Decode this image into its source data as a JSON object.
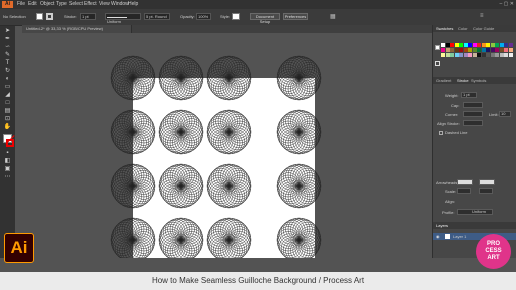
{
  "app": {
    "logo": "Ai",
    "logo_color": "#ff9a00"
  },
  "menubar": {
    "items": [
      "File",
      "Edit",
      "Object",
      "Type",
      "Select",
      "Effect",
      "View",
      "Window",
      "Help"
    ],
    "window_controls": "–  ▢  ✕"
  },
  "controlbar": {
    "selection": "No Selection",
    "stroke_label": "Stroke:",
    "stroke_value": "1 pt",
    "brush_label": "Uniform",
    "brush_style": "5 pt. Round",
    "opacity_label": "Opacity:",
    "opacity_value": "100%",
    "style_label": "Style:",
    "document_setup": "Document Setup",
    "preferences": "Preferences"
  },
  "document": {
    "tab_title": "Untitled-2* @ 33,33 % (RGB/CPU Preview)"
  },
  "panels": {
    "top_tabs": [
      "Swatches",
      "Color",
      "Color Guide"
    ],
    "mid_tabs": [
      "Gradient",
      "Stroke",
      "Symbols"
    ],
    "stroke": {
      "weight_label": "Weight:",
      "weight_value": "1 pt",
      "cap_label": "Cap:",
      "corner_label": "Corner:",
      "limit_label": "Limit:",
      "limit_value": "10",
      "align_label": "Align Stroke:",
      "dashed_label": "Dashed Line",
      "arrowheads_label": "Arrowheads:",
      "scale_label": "Scale:",
      "align_arrows_label": "Align:",
      "profile_label": "Profile:",
      "profile_value": "Uniform"
    },
    "layers": {
      "tab": "Layers",
      "layer_name": "Layer 1"
    }
  },
  "badge": {
    "line1": "PRO",
    "line2": "CESS",
    "line3": "ART"
  },
  "caption": "How to Make Seamless Guilloche Background  /  Process Art",
  "swatch_colors": [
    "#ffffff",
    "#000000",
    "#ff0000",
    "#ffff00",
    "#00ff00",
    "#00ffff",
    "#0000ff",
    "#ff00ff",
    "#ed1c24",
    "#f7941d",
    "#fff200",
    "#8dc63f",
    "#00a651",
    "#00aeef",
    "#2e3192",
    "#662d91",
    "#ec008c",
    "#c69c6d",
    "#8c6239",
    "#603913",
    "#9e0b0f",
    "#a0410d",
    "#aba000",
    "#598527",
    "#007236",
    "#0076a3",
    "#1b1464",
    "#440e62",
    "#9e005d",
    "#754c24",
    "#f26d7d",
    "#f9ad81",
    "#fff799",
    "#c4df9b",
    "#82ca9c",
    "#6dcff6",
    "#8393ca",
    "#a186be",
    "#f49ac1",
    "#c7b299",
    "#111111",
    "#333333",
    "#555555",
    "#777777",
    "#999999",
    "#bbbbbb",
    "#dddddd",
    "#eeeeee"
  ]
}
